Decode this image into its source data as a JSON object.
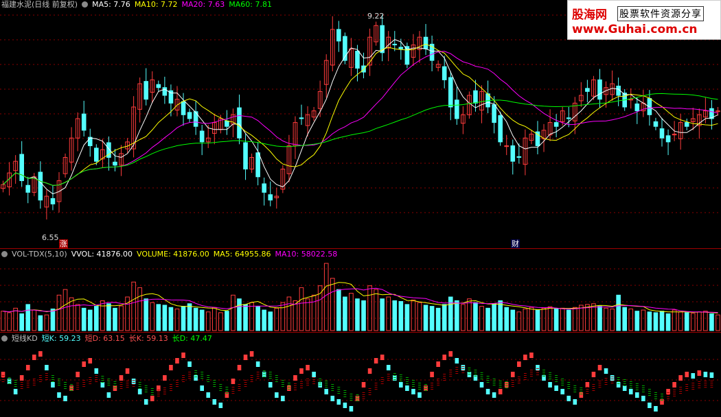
{
  "price_header": {
    "stock_title": "福建水泥(日线 前复权)",
    "ma5": "MA5: 7.76",
    "ma10": "MA10: 7.72",
    "ma20": "MA20: 7.63",
    "ma60": "MA60: 7.81"
  },
  "price_marks": {
    "high": "9.22",
    "low": "6.55",
    "event_rise": "涨",
    "event_fin": "财"
  },
  "vol_header": {
    "indicator": "VOL-TDX(5,10)",
    "vvol": "VVOL: 41876.00",
    "volume": "VOLUME: 41876.00",
    "ma5": "MA5: 64955.86",
    "ma10": "MA10: 58022.58"
  },
  "kd_header": {
    "indicator": "短线KD",
    "short_k": "短K: 59.23",
    "short_d": "短D: 63.15",
    "long_k": "长K: 59.13",
    "long_d": "长D: 47.47"
  },
  "logo": {
    "brand": "股海网",
    "slogan": "股票软件资源分享",
    "url": "www.Guhai.com.cn"
  },
  "colors": {
    "up": "#ff3c3c",
    "down": "#54ffff",
    "ma5": "#ffffff",
    "ma10": "#ffff00",
    "ma20": "#ff00ff",
    "ma60": "#00ff00",
    "grid": "#8b0000"
  },
  "chart_data": {
    "type": "candlestick",
    "price_range": [
      6.55,
      9.22
    ],
    "close": [
      7.0,
      7.15,
      7.3,
      7.05,
      6.9,
      7.1,
      6.8,
      6.85,
      6.75,
      7.05,
      7.35,
      7.6,
      7.85,
      7.7,
      7.5,
      7.3,
      7.45,
      7.35,
      7.25,
      7.4,
      7.55,
      8.0,
      8.3,
      8.1,
      8.35,
      8.25,
      8.15,
      8.05,
      8.1,
      7.9,
      7.85,
      7.75,
      7.55,
      7.6,
      7.8,
      7.85,
      7.75,
      7.9,
      7.6,
      7.2,
      7.35,
      7.1,
      6.9,
      6.8,
      6.85,
      7.2,
      7.5,
      7.8,
      7.85,
      7.9,
      7.95,
      8.2,
      8.6,
      9.0,
      8.85,
      8.6,
      8.75,
      8.5,
      8.45,
      8.9,
      9.05,
      8.7,
      8.9,
      8.8,
      8.75,
      8.55,
      8.8,
      8.9,
      8.75,
      8.6,
      8.55,
      8.35,
      8.0,
      7.85,
      7.9,
      8.15,
      8.05,
      8.2,
      8.0,
      7.8,
      7.55,
      7.5,
      7.3,
      7.35,
      7.6,
      7.65,
      7.5,
      7.7,
      7.8,
      7.75,
      7.95,
      7.85,
      8.05,
      8.15,
      8.2,
      8.35,
      8.1,
      8.25,
      8.3,
      8.15,
      8.0,
      8.1,
      7.95,
      8.05,
      7.9,
      7.75,
      7.6,
      7.55,
      7.65,
      7.8,
      7.75,
      7.85,
      7.9,
      7.95,
      7.85,
      7.95
    ],
    "volume": [
      52,
      48,
      60,
      45,
      70,
      55,
      40,
      42,
      58,
      95,
      110,
      88,
      70,
      60,
      55,
      65,
      80,
      72,
      60,
      66,
      90,
      130,
      115,
      85,
      75,
      70,
      68,
      62,
      58,
      65,
      72,
      60,
      55,
      50,
      62,
      48,
      52,
      95,
      85,
      70,
      75,
      65,
      55,
      50,
      60,
      75,
      90,
      80,
      115,
      85,
      95,
      120,
      180,
      140,
      110,
      90,
      100,
      85,
      80,
      120,
      110,
      85,
      90,
      80,
      78,
      70,
      82,
      75,
      68,
      65,
      60,
      70,
      90,
      80,
      70,
      85,
      75,
      65,
      60,
      72,
      80,
      62,
      55,
      50,
      58,
      62,
      55,
      60,
      64,
      58,
      60,
      55,
      62,
      68,
      70,
      72,
      65,
      60,
      58,
      95,
      62,
      58,
      52,
      55,
      50,
      48,
      52,
      45,
      55,
      50,
      48,
      46,
      50,
      52,
      45,
      42
    ],
    "short_k": [
      60,
      50,
      35,
      55,
      70,
      85,
      90,
      70,
      45,
      30,
      25,
      40,
      60,
      75,
      80,
      65,
      45,
      30,
      40,
      55,
      65,
      50,
      35,
      20,
      25,
      40,
      55,
      70,
      80,
      88,
      75,
      55,
      40,
      30,
      20,
      15,
      30,
      50,
      70,
      85,
      90,
      75,
      60,
      45,
      30,
      25,
      40,
      55,
      65,
      70,
      60,
      45,
      35,
      25,
      20,
      15,
      10,
      25,
      45,
      65,
      80,
      85,
      70,
      55,
      45,
      40,
      35,
      30,
      40,
      60,
      75,
      85,
      90,
      80,
      70,
      60,
      55,
      45,
      35,
      30,
      35,
      45,
      60,
      75,
      85,
      88,
      70,
      55,
      45,
      40,
      35,
      25,
      20,
      30,
      45,
      60,
      70,
      65,
      55,
      45,
      40,
      35,
      30,
      25,
      15,
      10,
      20,
      35,
      45,
      55,
      60,
      58,
      62,
      60,
      59
    ],
    "long_d": [
      55,
      52,
      48,
      45,
      47,
      50,
      55,
      58,
      55,
      50,
      45,
      42,
      44,
      48,
      52,
      55,
      54,
      50,
      46,
      45,
      47,
      48,
      45,
      40,
      36,
      34,
      37,
      42,
      48,
      55,
      60,
      62,
      60,
      55,
      48,
      42,
      38,
      38,
      42,
      48,
      55,
      60,
      62,
      60,
      55,
      48,
      44,
      43,
      46,
      50,
      52,
      50,
      47,
      42,
      38,
      33,
      28,
      27,
      30,
      36,
      44,
      52,
      57,
      58,
      56,
      52,
      48,
      44,
      42,
      44,
      50,
      57,
      63,
      67,
      68,
      66,
      63,
      59,
      54,
      50,
      47,
      46,
      48,
      53,
      58,
      63,
      65,
      63,
      59,
      55,
      50,
      45,
      40,
      37,
      38,
      42,
      47,
      51,
      53,
      52,
      49,
      46,
      43,
      40,
      35,
      30,
      28,
      30,
      34,
      38,
      42,
      44,
      46,
      47,
      47
    ]
  }
}
